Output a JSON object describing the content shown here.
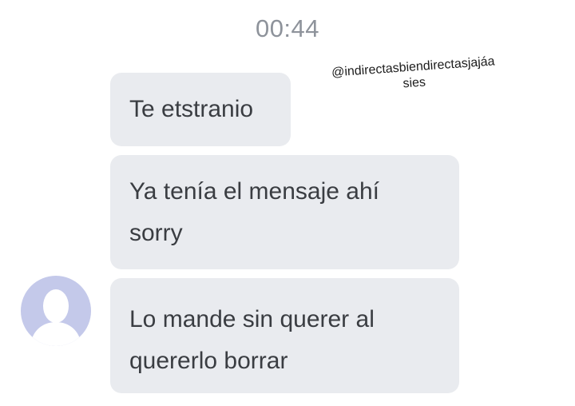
{
  "chat": {
    "timestamp": "00:44",
    "messages": [
      {
        "text": "Te etstranio"
      },
      {
        "line1": "Ya tenía el mensaje ahí",
        "line2": "sorry"
      },
      {
        "line1": "Lo mande sin querer al",
        "line2": "quererlo borrar"
      }
    ]
  },
  "watermark": {
    "line1": "@indirectasbiendirectasjajáa",
    "line2": "sies"
  },
  "colors": {
    "bubble_background": "#e9ebef",
    "bubble_text": "#3a3d42",
    "timestamp_text": "#8e939b",
    "avatar_background": "#c4c9ea"
  },
  "icons": {
    "avatar": "default-profile-silhouette-icon"
  }
}
